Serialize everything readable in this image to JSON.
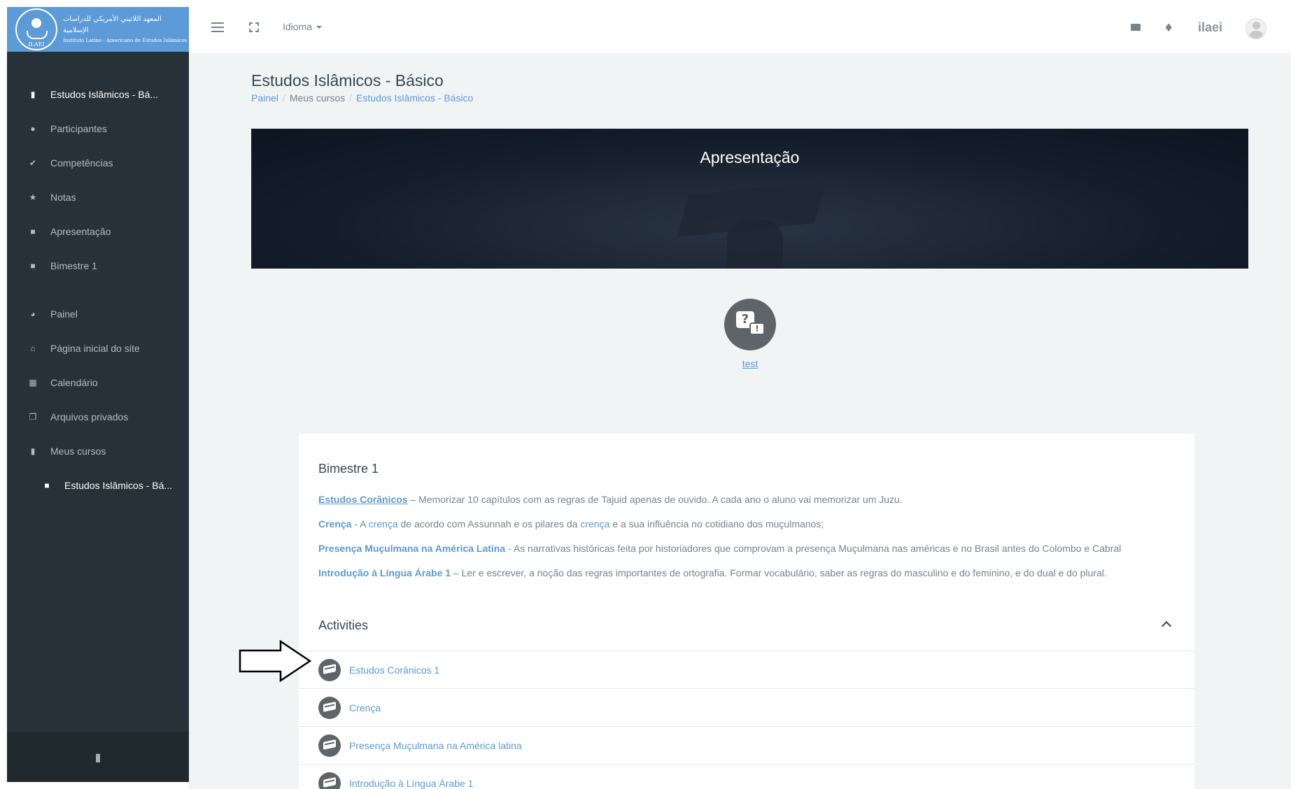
{
  "logo": {
    "arabic": "المعهد اللاتيني الأمريكي للدراسات الإسلامية",
    "latin": "Instituto Latino - Americano de Estudos Islâmicos",
    "abbr": "ILAEI"
  },
  "sidebar": {
    "items": [
      {
        "label": "Estudos Islâmicos - Bá...",
        "icon": "book-icon",
        "active": true
      },
      {
        "label": "Participantes",
        "icon": "users-icon"
      },
      {
        "label": "Competências",
        "icon": "check-circle-icon"
      },
      {
        "label": "Notas",
        "icon": "star-icon"
      },
      {
        "label": "Apresentação",
        "icon": "folder-icon"
      },
      {
        "label": "Bimestre 1",
        "icon": "folder-icon"
      },
      {
        "label": "Painel",
        "icon": "dashboard-icon"
      },
      {
        "label": "Página inicial do site",
        "icon": "home-icon"
      },
      {
        "label": "Calendário",
        "icon": "calendar-icon"
      },
      {
        "label": "Arquivos privados",
        "icon": "files-icon"
      },
      {
        "label": "Meus cursos",
        "icon": "book-icon"
      },
      {
        "label": "Estudos Islâmicos - Bá...",
        "icon": "folder-icon",
        "sub": true
      }
    ]
  },
  "topbar": {
    "language_label": "Idioma",
    "username": "ilaei"
  },
  "page": {
    "title": "Estudos Islâmicos - Básico",
    "breadcrumb": [
      "Painel",
      "Meus cursos",
      "Estudos Islâmicos - Básico"
    ]
  },
  "banner": {
    "title": "Apresentação"
  },
  "intro_activity": {
    "label": "test"
  },
  "section": {
    "title": "Bimestre 1",
    "lines": [
      {
        "strong": "Estudos Corânicos",
        "rest": " – Memorizar 10 capítulos com as regras de Tajuid apenas de ouvido. A cada ano o aluno vai memorizar um Juzu."
      },
      {
        "strong": "Crença",
        "pre": " - A ",
        "link1": "crença",
        "mid": " de acordo com Assunnah e os pilares da ",
        "link2": "crença",
        "end": " e a sua influência no cotidiano dos muçulmanos;"
      },
      {
        "strong": "Presença Muçulmana na América Latina",
        "rest": " - As narrativas históricas feita por historiadores que comprovam a presença Muçulmana nas américas e no Brasil antes do Colombo e Cabral"
      },
      {
        "strong": "Introdução à Língua Árabe 1",
        "rest": " – Ler e escrever, a noção das regras importantes de ortografia. Formar vocabulário, saber as regras do masculino e do feminino, e do dual e do plural."
      }
    ],
    "activities_title": "Activities",
    "activities": [
      "Estudos Corânicos 1",
      "Crença",
      "Presença Muçulmana na América latina",
      "Introdução à Língua Árabe 1"
    ]
  }
}
